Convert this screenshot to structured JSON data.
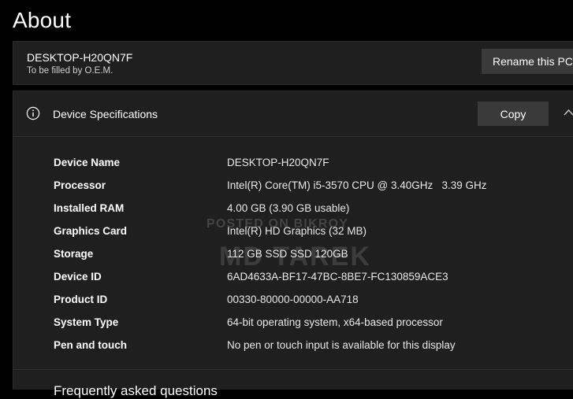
{
  "page": {
    "title": "About"
  },
  "pc": {
    "name": "DESKTOP-H20QN7F",
    "subtitle": "To be filled by O.E.M.",
    "rename_label": "Rename this PC"
  },
  "specs": {
    "title": "Device Specifications",
    "copy_label": "Copy",
    "rows": [
      {
        "label": "Device Name",
        "value": "DESKTOP-H20QN7F"
      },
      {
        "label": "Processor",
        "value": "Intel(R) Core(TM) i5-3570 CPU @ 3.40GHz   3.39 GHz"
      },
      {
        "label": "Installed RAM",
        "value": "4.00 GB (3.90 GB usable)"
      },
      {
        "label": "Graphics Card",
        "value": "Intel(R) HD Graphics (32 MB)"
      },
      {
        "label": "Storage",
        "value": "112 GB SSD SSD 120GB"
      },
      {
        "label": "Device ID",
        "value": "6AD4633A-BF17-47BC-8BE7-FC130859ACE3"
      },
      {
        "label": "Product ID",
        "value": "00330-80000-00000-AA718"
      },
      {
        "label": "System Type",
        "value": "64-bit operating system, x64-based processor"
      },
      {
        "label": "Pen and touch",
        "value": "No pen or touch input is available for this display"
      }
    ]
  },
  "related": {
    "heading": "Frequently asked questions"
  },
  "watermark": {
    "line1": "POSTED ON BIKROY",
    "line2": "MD TAREK"
  },
  "colors": {
    "background": "#000000",
    "card": "#1f1f1f",
    "button": "#3a3a3a",
    "text": "#ffffff"
  },
  "icons": {
    "info": "info-circle-icon",
    "collapse": "chevron-up-icon"
  }
}
